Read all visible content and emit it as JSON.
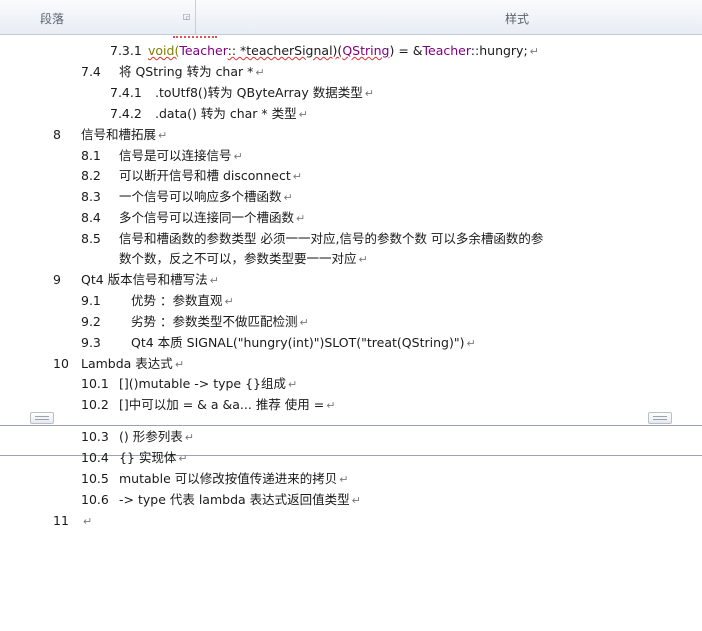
{
  "ribbon": {
    "paragraph_group": "段落",
    "style_group": "样式",
    "launcher_icon": "dialog-launcher-icon"
  },
  "doc": {
    "line_7_3_1": {
      "num": "7.3.1",
      "pre": "void(",
      "cls1": "Teacher",
      "mid": ":: *teacherSignal)(",
      "cls2": "QString",
      "post": ") = &",
      "cls3": "Teacher",
      "tail": "::hungry;"
    },
    "l7_4": {
      "num": "7.4",
      "text": "将 QString  转为  char *"
    },
    "l7_4_1": {
      "num": "7.4.1",
      "text": ".toUtf8()转为    QByteArray 数据类型"
    },
    "l7_4_2": {
      "num": "7.4.2",
      "text": ".data() 转为   char *  类型"
    },
    "l8": {
      "num": "8",
      "text": "信号和槽拓展"
    },
    "l8_1": {
      "num": "8.1",
      "text": "信号是可以连接信号"
    },
    "l8_2": {
      "num": "8.2",
      "text": "可以断开信号和槽   disconnect"
    },
    "l8_3": {
      "num": "8.3",
      "text": "一个信号可以响应多个槽函数"
    },
    "l8_4": {
      "num": "8.4",
      "text": "多个信号可以连接同一个槽函数"
    },
    "l8_5": {
      "num": "8.5",
      "text": "信号和槽函数的参数类型  必须一一对应,信号的参数个数  可以多余槽函数的参",
      "text2": "数个数，反之不可以，参数类型要一一对应"
    },
    "l9": {
      "num": "9",
      "text": "Qt4 版本信号和槽写法"
    },
    "l9_1": {
      "num": "9.1",
      "text": "优势  ：参数直观"
    },
    "l9_2": {
      "num": "9.2",
      "text": "劣势  ：参数类型不做匹配检测"
    },
    "l9_3": {
      "num": "9.3",
      "text": "Qt4 本质       SIGNAL(\"hungry(int)\")SLOT(\"treat(QString)\")"
    },
    "l10": {
      "num": "10",
      "text": "Lambda 表达式"
    },
    "l10_1": {
      "num": "10.1",
      "text": "[]()mutable    -> type {}组成"
    },
    "l10_2": {
      "num": "10.2",
      "text": "[]中可以加  =    &    a    &a...  推荐  使用  ="
    },
    "l10_3": {
      "num": "10.3",
      "text": "()  形参列表"
    },
    "l10_4": {
      "num": "10.4",
      "text": "{}  实现体"
    },
    "l10_5": {
      "num": "10.5",
      "text": "mutable 可以修改按值传递进来的拷贝"
    },
    "l10_6": {
      "num": "10.6",
      "text": "-> type  代表 lambda 表达式返回值类型"
    },
    "l11": {
      "num": "11",
      "text": ""
    },
    "paragraph_mark": "↵"
  }
}
